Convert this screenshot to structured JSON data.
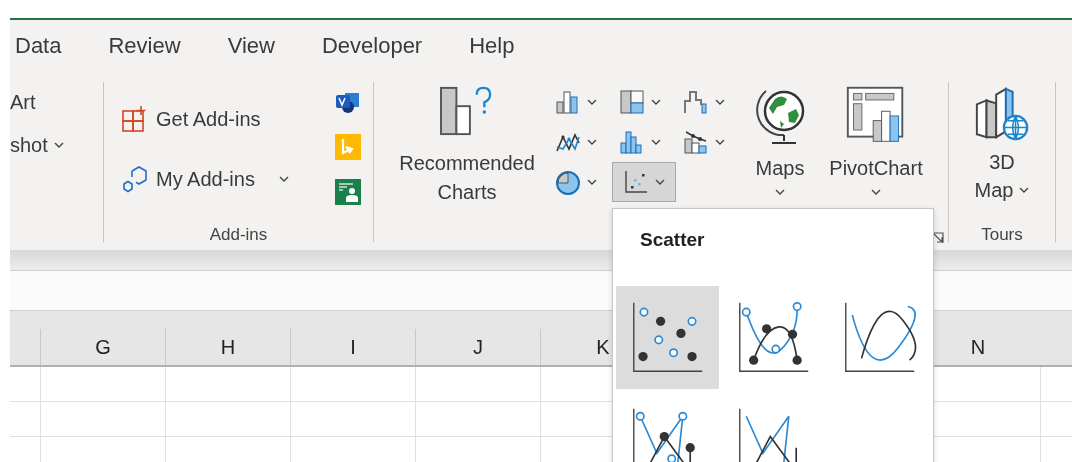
{
  "tabs": [
    {
      "label": "Data",
      "selected": false
    },
    {
      "label": "Review",
      "selected": false
    },
    {
      "label": "View",
      "selected": false
    },
    {
      "label": "Developer",
      "selected": false
    },
    {
      "label": "Help",
      "selected": false
    }
  ],
  "ribbon": {
    "cut_group": {
      "items": [
        {
          "label": "Art",
          "has_menu": false
        },
        {
          "label": "shot",
          "has_menu": true
        }
      ]
    },
    "addins_group": {
      "label": "Add-ins",
      "buttons": [
        {
          "label": "Get Add-ins",
          "kind": "get",
          "has_menu": false
        },
        {
          "label": "My Add-ins",
          "kind": "my",
          "has_menu": true
        }
      ],
      "app_icons": [
        {
          "kind": "shapes"
        },
        {
          "kind": "tile"
        },
        {
          "kind": "person"
        }
      ]
    },
    "charts_group": {
      "recommended": {
        "lines": [
          "Recommended",
          "Charts"
        ]
      },
      "chart_types": [
        {
          "kind": "column",
          "selected": false
        },
        {
          "kind": "hierarchy",
          "selected": false
        },
        {
          "kind": "waterfall",
          "selected": false
        },
        {
          "kind": "line",
          "selected": false
        },
        {
          "kind": "statistic",
          "selected": false
        },
        {
          "kind": "combo",
          "selected": false
        },
        {
          "kind": "pie",
          "selected": false
        },
        {
          "kind": "scatter",
          "selected": true
        }
      ],
      "large": [
        {
          "label": "Maps",
          "kind": "maps"
        },
        {
          "label": "PivotChart",
          "kind": "pivot"
        }
      ]
    },
    "tours_group": {
      "label": "Tours",
      "button": {
        "lines": [
          "3D",
          "Map"
        ]
      }
    }
  },
  "sheet": {
    "columns_left": [
      "G",
      "H",
      "I",
      "J",
      "K"
    ],
    "columns_right": [
      "N"
    ]
  },
  "scatter_menu": {
    "title": "Scatter",
    "options": [
      {
        "kind": "markers",
        "selected": true
      },
      {
        "kind": "smooth-markers",
        "selected": false
      },
      {
        "kind": "smooth",
        "selected": false
      },
      {
        "kind": "straight-markers",
        "selected": false
      },
      {
        "kind": "straight",
        "selected": false
      }
    ]
  }
}
